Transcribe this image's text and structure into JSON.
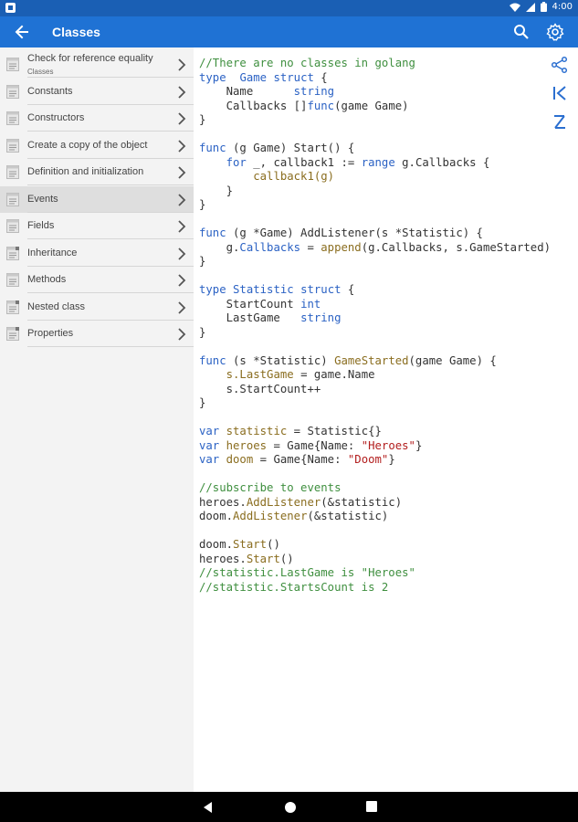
{
  "status_bar": {
    "time": "4:00"
  },
  "app_bar": {
    "title": "Classes"
  },
  "sidebar": {
    "items": [
      {
        "label": "Check for reference equality",
        "sub": "Classes",
        "active": false,
        "locked": false
      },
      {
        "label": "Constants",
        "active": false,
        "locked": false
      },
      {
        "label": "Constructors",
        "active": false,
        "locked": false
      },
      {
        "label": "Create a copy of the object",
        "active": false,
        "locked": false
      },
      {
        "label": "Definition and initialization",
        "active": false,
        "locked": false
      },
      {
        "label": "Events",
        "active": true,
        "locked": false
      },
      {
        "label": "Fields",
        "active": false,
        "locked": false
      },
      {
        "label": "Inheritance",
        "active": false,
        "locked": true
      },
      {
        "label": "Methods",
        "active": false,
        "locked": false
      },
      {
        "label": "Nested class",
        "active": false,
        "locked": true
      },
      {
        "label": "Properties",
        "active": false,
        "locked": true
      }
    ]
  },
  "code": {
    "lines": [
      [
        [
          "cm",
          "//There are no classes in golang"
        ]
      ],
      [
        [
          "kw",
          "type"
        ],
        [
          "",
          "  "
        ],
        [
          "tp",
          "Game"
        ],
        [
          "",
          " "
        ],
        [
          "kw",
          "struct"
        ],
        [
          "",
          " {"
        ]
      ],
      [
        [
          "",
          "    Name      "
        ],
        [
          "kw",
          "string"
        ]
      ],
      [
        [
          "",
          "    Callbacks []"
        ],
        [
          "kw",
          "func"
        ],
        [
          "",
          "(game Game)"
        ]
      ],
      [
        [
          "",
          "}"
        ]
      ],
      [
        [
          "",
          ""
        ]
      ],
      [
        [
          "kw",
          "func"
        ],
        [
          "",
          " (g Game) Start() {"
        ]
      ],
      [
        [
          "",
          "    "
        ],
        [
          "kw",
          "for"
        ],
        [
          "",
          ""
        ],
        [
          "",
          " _, callback1 := "
        ],
        [
          "kw",
          "range"
        ],
        [
          "",
          " g.Callbacks {"
        ]
      ],
      [
        [
          "",
          "        "
        ],
        [
          "fn",
          "callback1(g)"
        ]
      ],
      [
        [
          "",
          "    }"
        ]
      ],
      [
        [
          "",
          "}"
        ]
      ],
      [
        [
          "",
          ""
        ]
      ],
      [
        [
          "kw",
          "func"
        ],
        [
          "",
          " (g *Game) AddListener(s *Statistic) {"
        ]
      ],
      [
        [
          "",
          "    g."
        ],
        [
          "kw",
          "Callbacks"
        ],
        [
          "",
          " = "
        ],
        [
          "fn",
          "append"
        ],
        [
          "",
          "(g.Callbacks, s.GameStarted)"
        ]
      ],
      [
        [
          "",
          "}"
        ]
      ],
      [
        [
          "",
          ""
        ]
      ],
      [
        [
          "kw",
          "type"
        ],
        [
          "",
          " "
        ],
        [
          "tp",
          "Statistic"
        ],
        [
          "",
          " "
        ],
        [
          "kw",
          "struct"
        ],
        [
          "",
          " {"
        ]
      ],
      [
        [
          "",
          "    StartCount "
        ],
        [
          "kw",
          "int"
        ]
      ],
      [
        [
          "",
          "    LastGame   "
        ],
        [
          "kw",
          "string"
        ]
      ],
      [
        [
          "",
          "}"
        ]
      ],
      [
        [
          "",
          ""
        ]
      ],
      [
        [
          "kw",
          "func"
        ],
        [
          "",
          " (s *Statistic) "
        ],
        [
          "fn",
          "GameStarted"
        ],
        [
          "",
          "(game Game) {"
        ]
      ],
      [
        [
          "",
          "    "
        ],
        [
          "fn",
          "s.LastGame"
        ],
        [
          "",
          " = game.Name"
        ]
      ],
      [
        [
          "",
          "    s.StartCount++"
        ]
      ],
      [
        [
          "",
          "}"
        ]
      ],
      [
        [
          "",
          ""
        ]
      ],
      [
        [
          "kw",
          "var"
        ],
        [
          "",
          " "
        ],
        [
          "fn",
          "statistic"
        ],
        [
          "",
          " = Statistic{}"
        ]
      ],
      [
        [
          "kw",
          "var"
        ],
        [
          "",
          " "
        ],
        [
          "fn",
          "heroes"
        ],
        [
          "",
          " = Game{Name: "
        ],
        [
          "st",
          "\"Heroes\""
        ],
        [
          "",
          "}"
        ]
      ],
      [
        [
          "kw",
          "var"
        ],
        [
          "",
          " "
        ],
        [
          "fn",
          "doom"
        ],
        [
          "",
          " = Game{Name: "
        ],
        [
          "st",
          "\"Doom\""
        ],
        [
          "",
          "}"
        ]
      ],
      [
        [
          "",
          ""
        ]
      ],
      [
        [
          "cm",
          "//subscribe to events"
        ]
      ],
      [
        [
          "",
          "heroes."
        ],
        [
          "fn",
          "AddListener"
        ],
        [
          "",
          "(&statistic)"
        ]
      ],
      [
        [
          "",
          "doom."
        ],
        [
          "fn",
          "AddListener"
        ],
        [
          "",
          "(&statistic)"
        ]
      ],
      [
        [
          "",
          ""
        ]
      ],
      [
        [
          "",
          "doom."
        ],
        [
          "fn",
          "Start"
        ],
        [
          "",
          "()"
        ]
      ],
      [
        [
          "",
          "heroes."
        ],
        [
          "fn",
          "Start"
        ],
        [
          "",
          "()"
        ]
      ],
      [
        [
          "cm",
          "//statistic.LastGame is \"Heroes\""
        ]
      ],
      [
        [
          "cm",
          "//statistic.StartsCount is 2"
        ]
      ]
    ]
  },
  "icons": {
    "back": "arrow-back-icon",
    "search": "search-icon",
    "settings": "gear-icon",
    "share": "share-icon",
    "first": "skip-first-icon",
    "sort": "sort-icon"
  },
  "colors": {
    "app_bar": "#1f72d4",
    "status_bar": "#1a5fb4",
    "comment": "#3f8f3f",
    "keyword": "#2b62c4",
    "function": "#8a6d1f",
    "string": "#b21d1d"
  }
}
